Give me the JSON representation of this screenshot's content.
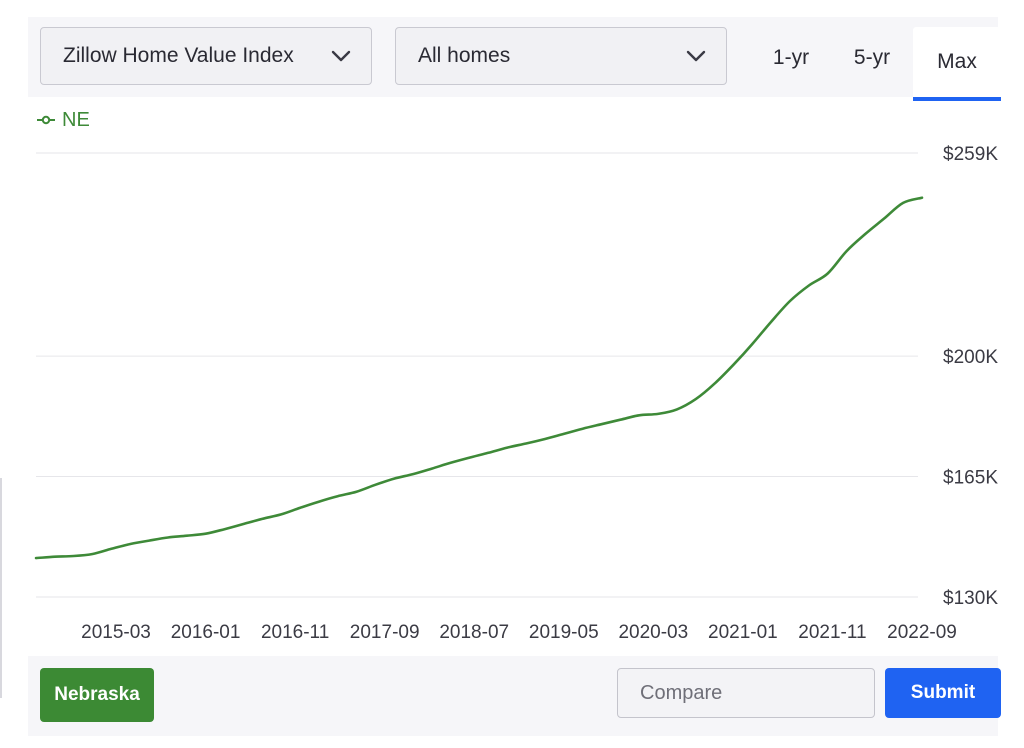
{
  "controls": {
    "metric_select": {
      "value": "Zillow Home Value Index"
    },
    "home_type_select": {
      "value": "All homes"
    },
    "range_tabs": [
      {
        "label": "1-yr",
        "active": false
      },
      {
        "label": "5-yr",
        "active": false
      },
      {
        "label": "Max",
        "active": true
      }
    ]
  },
  "actions": {
    "state_button": "Nebraska",
    "compare_placeholder": "Compare",
    "submit_label": "Submit"
  },
  "colors": {
    "series": "#3e8a38",
    "accent": "#1f63f2",
    "state_button": "#3c8a34"
  },
  "icons": {
    "legend": "line-marker-icon",
    "select": "chevron-down-icon"
  },
  "chart_data": {
    "type": "line",
    "legend_placement": "top-left",
    "grid": true,
    "ylim": [
      130000,
      259000
    ],
    "y_ticks": [
      {
        "value": 130000,
        "label": "$130K"
      },
      {
        "value": 165000,
        "label": "$165K"
      },
      {
        "value": 200000,
        "label": "$200K"
      },
      {
        "value": 259000,
        "label": "$259K"
      }
    ],
    "x_ticks": [
      "2015-03",
      "2016-01",
      "2016-11",
      "2017-09",
      "2018-07",
      "2019-05",
      "2020-03",
      "2021-01",
      "2021-11",
      "2022-09"
    ],
    "series": [
      {
        "name": "NE",
        "x": [
          "2014-10",
          "2014-12",
          "2015-02",
          "2015-04",
          "2015-06",
          "2015-08",
          "2015-10",
          "2015-12",
          "2016-02",
          "2016-04",
          "2016-06",
          "2016-08",
          "2016-10",
          "2016-12",
          "2017-02",
          "2017-04",
          "2017-06",
          "2017-08",
          "2017-10",
          "2017-12",
          "2018-02",
          "2018-04",
          "2018-06",
          "2018-08",
          "2018-10",
          "2018-12",
          "2019-02",
          "2019-04",
          "2019-06",
          "2019-08",
          "2019-10",
          "2019-12",
          "2020-02",
          "2020-04",
          "2020-06",
          "2020-08",
          "2020-10",
          "2020-12",
          "2021-02",
          "2021-04",
          "2021-06",
          "2021-08",
          "2021-10",
          "2021-12",
          "2022-02",
          "2022-04",
          "2022-06",
          "2022-08"
        ],
        "values": [
          141300,
          141700,
          141900,
          142500,
          144000,
          145400,
          146400,
          147300,
          147800,
          148400,
          149700,
          151200,
          152700,
          154000,
          155900,
          157700,
          159300,
          160600,
          162600,
          164400,
          165700,
          167300,
          169000,
          170500,
          171900,
          173400,
          174600,
          175900,
          177400,
          178900,
          180200,
          181500,
          182800,
          183200,
          184500,
          187500,
          192000,
          197500,
          203500,
          210000,
          216000,
          220500,
          224000,
          230500,
          235500,
          240000,
          244500,
          246000
        ]
      }
    ]
  }
}
